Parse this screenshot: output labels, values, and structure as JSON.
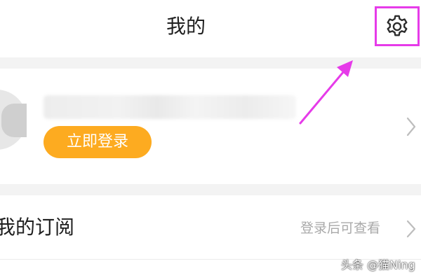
{
  "header": {
    "title": "我的",
    "settings_icon": "gear-icon"
  },
  "profile": {
    "login_button_label": "立即登录",
    "avatar_icon": "avatar-icon",
    "chevron_icon": "chevron-right-icon"
  },
  "subscription": {
    "label": "我的订阅",
    "hint": "登录后可查看",
    "chevron_icon": "chevron-right-icon"
  },
  "annotation": {
    "highlight_color": "#e63be9"
  },
  "watermark": {
    "text": "头条 @猫Ning"
  },
  "colors": {
    "accent_orange": "#fdab20",
    "separator_gray": "#f3f3f3",
    "hint_gray": "#a9a9a9"
  }
}
